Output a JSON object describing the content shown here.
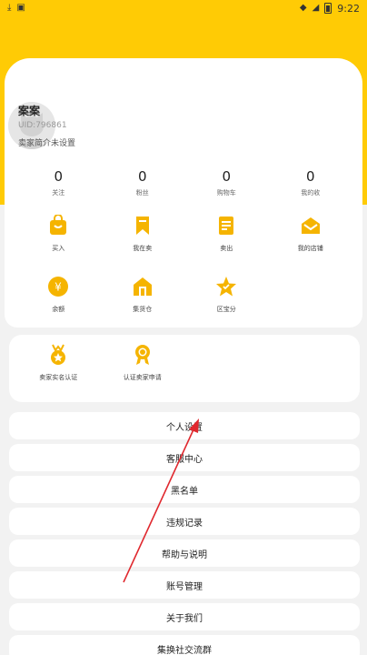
{
  "status_bar": {
    "time": "9:22",
    "left_icons": [
      "download-icon",
      "photo-icon"
    ],
    "right_icons": [
      "wifi-icon",
      "signal-icon",
      "battery-icon"
    ]
  },
  "profile": {
    "name": "案案",
    "uid": "UID:796861",
    "intro": "卖家简介未设置"
  },
  "stats": [
    {
      "value": "0",
      "label": "关注"
    },
    {
      "value": "0",
      "label": "粉丝"
    },
    {
      "value": "0",
      "label": "购物车"
    },
    {
      "value": "0",
      "label": "我的收"
    }
  ],
  "grid_row1": [
    {
      "label": "买入",
      "icon": "bag-icon"
    },
    {
      "label": "我在卖",
      "icon": "bookmark-icon"
    },
    {
      "label": "卖出",
      "icon": "document-icon"
    },
    {
      "label": "我的店铺",
      "icon": "mail-icon"
    }
  ],
  "grid_row2": [
    {
      "label": "余额",
      "icon": "coin-icon"
    },
    {
      "label": "集货仓",
      "icon": "warehouse-icon"
    },
    {
      "label": "区宝分",
      "icon": "star-icon"
    }
  ],
  "cert": [
    {
      "label": "卖家实名认证",
      "icon": "medal-icon"
    },
    {
      "label": "认证卖家申请",
      "icon": "ribbon-icon"
    }
  ],
  "menu": [
    {
      "label": "个人设置"
    },
    {
      "label": "客服中心"
    },
    {
      "label": "黑名单"
    },
    {
      "label": "违规记录"
    },
    {
      "label": "帮助与说明"
    },
    {
      "label": "账号管理"
    },
    {
      "label": "关于我们"
    },
    {
      "label": "集换社交流群"
    }
  ],
  "colors": {
    "brand_yellow": "#FFCB05",
    "icon_orange": "#F5B400",
    "arrow_red": "#E0282E"
  }
}
